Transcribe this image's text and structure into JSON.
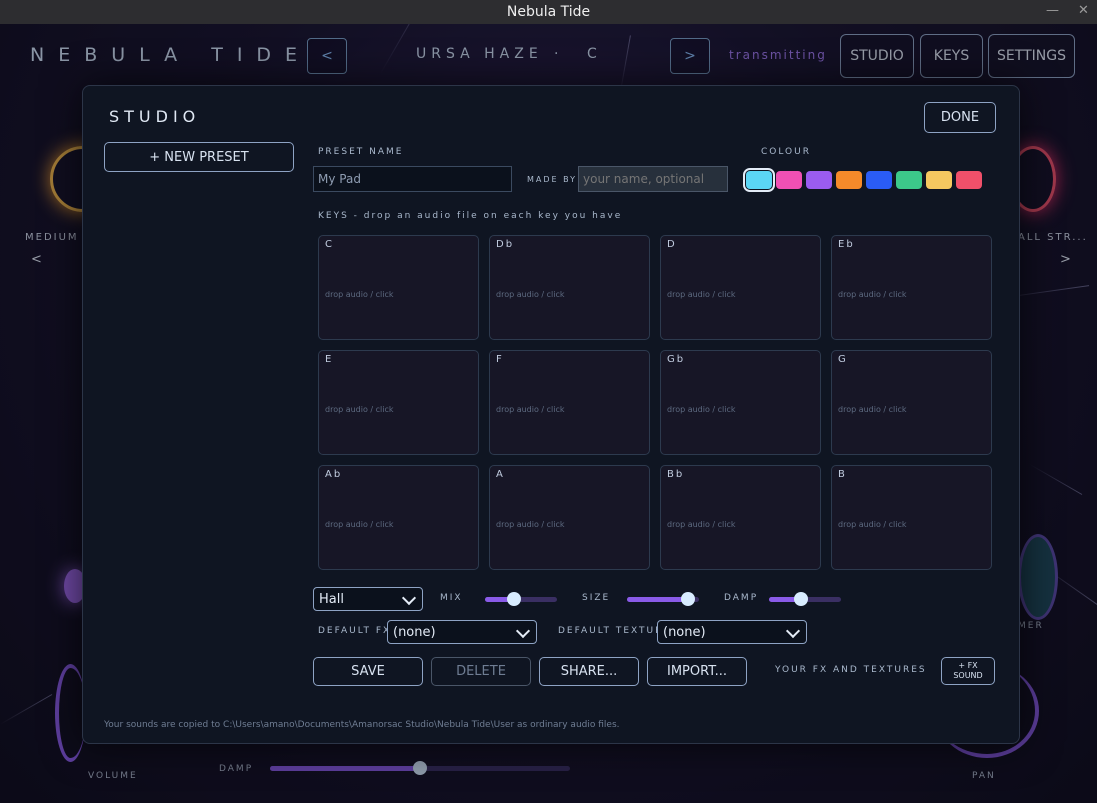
{
  "window": {
    "title": "Nebula Tide"
  },
  "app": {
    "brand": "NEBULA TIDE",
    "prev_label": "<",
    "next_label": ">",
    "preset_name": "URSA HAZE",
    "preset_sep": "·",
    "preset_key": "C",
    "status": "transmitting",
    "top_buttons": [
      "STUDIO",
      "KEYS",
      "SETTINGS"
    ],
    "left_label": "MEDIUM I",
    "right_label": "ALL STR...",
    "left_arrow": "<",
    "right_arrow": ">",
    "right_bottom_label": "MER",
    "volume_label": "VOLUME",
    "pan_label": "PAN",
    "damp_label": "DAMP",
    "damp_value": 0.5
  },
  "studio": {
    "title": "STUDIO",
    "done": "DONE",
    "new_preset": "+ NEW PRESET",
    "preset_name_label": "PRESET NAME",
    "preset_name_value": "My Pad",
    "made_by_label": "MADE BY",
    "made_by_placeholder": "your name, optional",
    "colour_label": "COLOUR",
    "colours": [
      "#5bd6f5",
      "#f050b4",
      "#9a5cf0",
      "#f58a2a",
      "#2a5cf5",
      "#3cc98a",
      "#f5c860",
      "#f0506a"
    ],
    "keys_title": "KEYS  -  drop an audio file on each key you have",
    "key_hint": "drop audio  /  click",
    "keys": [
      "C",
      "Db",
      "D",
      "Eb",
      "E",
      "F",
      "Gb",
      "G",
      "Ab",
      "A",
      "Bb",
      "B"
    ],
    "reverb": "Hall",
    "mix_label": "MIX",
    "mix_value": 0.4,
    "size_label": "SIZE",
    "size_value": 0.85,
    "damp_label": "DAMP",
    "damp_value": 0.45,
    "default_fx_label": "DEFAULT FX",
    "default_fx_value": "(none)",
    "default_texture_label": "DEFAULT TEXTURE",
    "default_texture_value": "(none)",
    "save": "SAVE",
    "delete": "DELETE",
    "share": "SHARE...",
    "import": "IMPORT...",
    "your_fx_label": "YOUR FX AND TEXTURES",
    "fx_sound_line1": "+ FX",
    "fx_sound_line2": "SOUND",
    "footer": "Your sounds are copied to  C:\\Users\\amano\\Documents\\Amanorsac Studio\\Nebula Tide\\User  as ordinary audio files."
  }
}
